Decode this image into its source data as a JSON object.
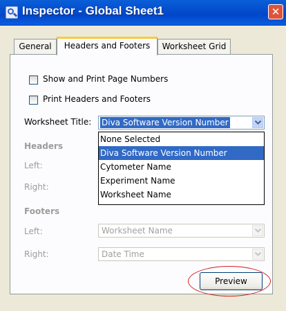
{
  "window": {
    "title": "Inspector - Global Sheet1",
    "close_glyph": "✕"
  },
  "tabs": [
    {
      "label": "General"
    },
    {
      "label": "Headers and Footers",
      "active": true
    },
    {
      "label": "Worksheet Grid"
    }
  ],
  "options": {
    "show_page_numbers": {
      "label": "Show and Print Page Numbers",
      "checked": false
    },
    "print_headers_footers": {
      "label": "Print Headers and Footers",
      "checked": false
    }
  },
  "worksheet_title": {
    "label": "Worksheet Title:",
    "value": "Diva Software Version Number",
    "options": [
      "None Selected",
      "Diva Software Version Number",
      "Cytometer Name",
      "Experiment Name",
      "Worksheet Name"
    ],
    "selected_index": 1
  },
  "headers": {
    "heading": "Headers",
    "left_label": "Left:",
    "right_label": "Right:"
  },
  "footers": {
    "heading": "Footers",
    "left_label": "Left:",
    "left_value": "Worksheet Name",
    "right_label": "Right:",
    "right_value": "Date Time"
  },
  "preview_button": {
    "label": "Preview"
  },
  "colors": {
    "title_bar": "#0054e3",
    "selection": "#316ac5",
    "highlight_ring": "#d21e1e",
    "tab_accent": "#ffc83c"
  }
}
